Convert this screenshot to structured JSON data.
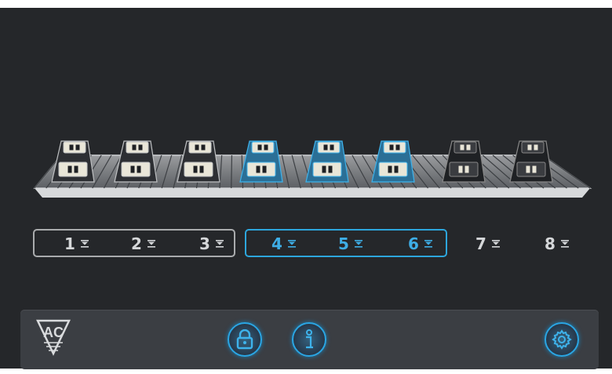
{
  "logo": {
    "text": "AC"
  },
  "slots": [
    {
      "number": "1",
      "state": "group1"
    },
    {
      "number": "2",
      "state": "group1"
    },
    {
      "number": "3",
      "state": "group1"
    },
    {
      "number": "4",
      "state": "selected"
    },
    {
      "number": "5",
      "state": "selected"
    },
    {
      "number": "6",
      "state": "selected"
    },
    {
      "number": "7",
      "state": "inactive"
    },
    {
      "number": "8",
      "state": "inactive"
    }
  ],
  "colors": {
    "accent": "#2da6dc",
    "frame_grey": "#a9abad",
    "background": "#25272a",
    "bar": "#3b3e43"
  },
  "toolbar": {
    "lock_icon": "lock-icon",
    "info_icon": "info-icon",
    "settings_icon": "gear-icon"
  }
}
